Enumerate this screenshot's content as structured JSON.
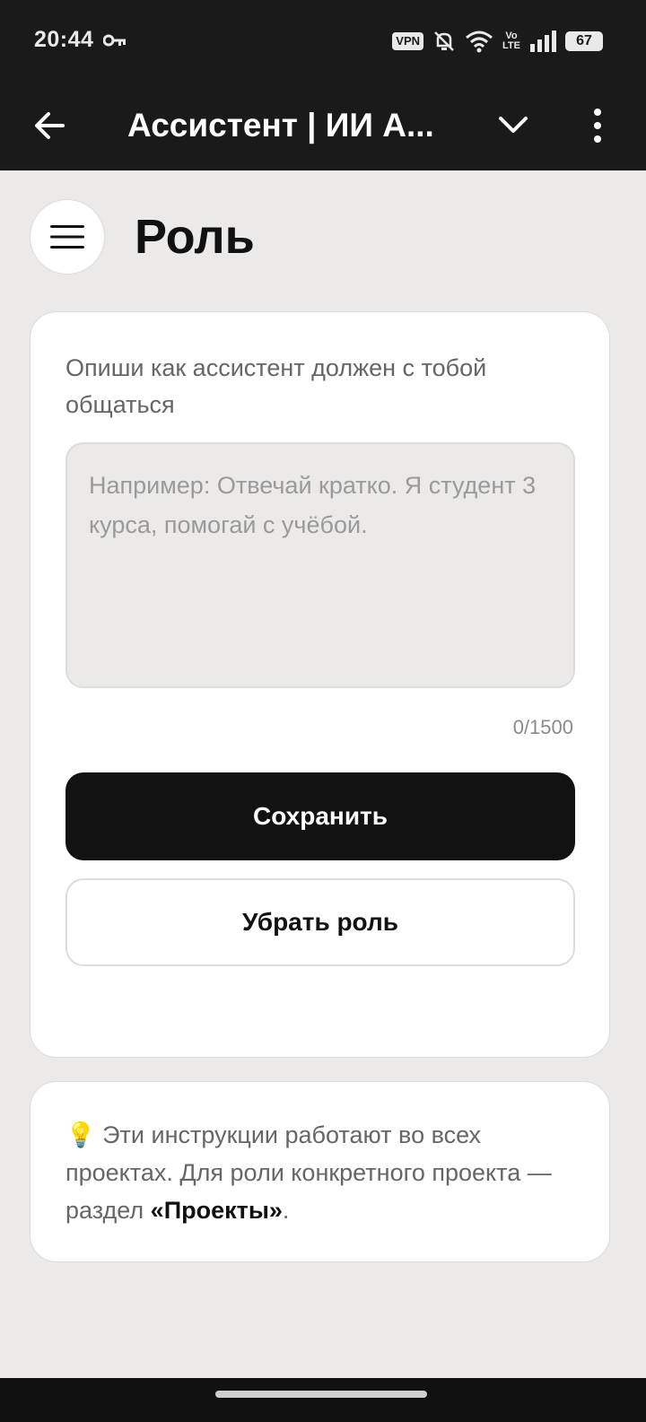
{
  "status_bar": {
    "time": "20:44",
    "vpn": "VPN",
    "volte_top": "Vo",
    "volte_bottom": "LTE",
    "battery": "67",
    "icons": [
      "key-icon",
      "vpn-icon",
      "bell-muted-icon",
      "wifi-icon",
      "volte-icon",
      "signal-icon",
      "battery-icon"
    ]
  },
  "app_bar": {
    "title": "Ассистент | ИИ А...",
    "icons": [
      "back-arrow-icon",
      "chevron-down-icon",
      "more-vertical-icon"
    ]
  },
  "header": {
    "title": "Роль",
    "menu_icon": "hamburger-menu-icon"
  },
  "role_card": {
    "description": "Опиши как ассистент должен с тобой общаться",
    "textarea": {
      "value": "",
      "placeholder": "Например: Отвечай кратко. Я студент 3 курса, помогай с учёбой."
    },
    "counter": "0/1500",
    "save_label": "Сохранить",
    "remove_label": "Убрать роль"
  },
  "info_card": {
    "emoji": "💡",
    "text": "Эти инструкции работают во всех проектах. Для роли конкретного проекта — раздел",
    "link": "«Проекты»",
    "suffix": "."
  },
  "colors": {
    "background": "#ebeae8",
    "bar": "#1a1a1a",
    "primary_button": "#121212",
    "card": "#ffffff"
  }
}
